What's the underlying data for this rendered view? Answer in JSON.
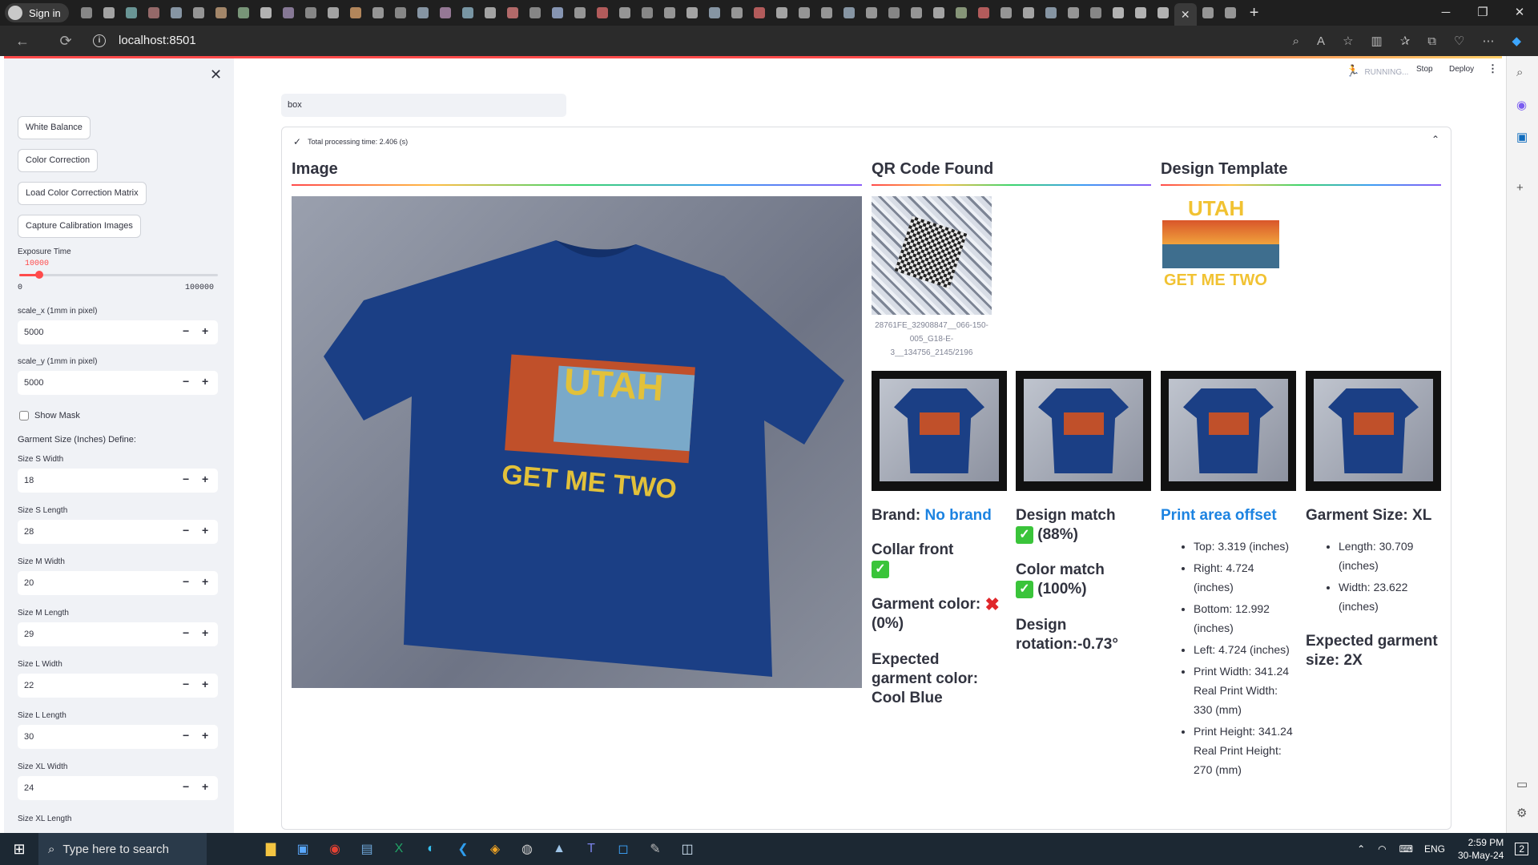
{
  "browser": {
    "signin": "Sign in",
    "url": "localhost:8501"
  },
  "streamlit": {
    "status": "RUNNING...",
    "stop": "Stop",
    "deploy": "Deploy",
    "box_value": "box",
    "processing": "Total processing time: 2.406 (s)"
  },
  "sidebar": {
    "buttons": [
      "White Balance",
      "Color Correction",
      "Load Color Correction Matrix",
      "Capture Calibration Images"
    ],
    "exposure": {
      "label": "Exposure Time",
      "value": "10000",
      "min": "0",
      "max": "100000",
      "fraction": 0.1
    },
    "scale_x": {
      "label": "scale_x (1mm in pixel)",
      "value": "5000"
    },
    "scale_y": {
      "label": "scale_y (1mm in pixel)",
      "value": "5000"
    },
    "show_mask": "Show Mask",
    "garment_define": "Garment Size (Inches) Define:",
    "sizes": [
      {
        "label": "Size S Width",
        "value": "18"
      },
      {
        "label": "Size S Length",
        "value": "28"
      },
      {
        "label": "Size M Width",
        "value": "20"
      },
      {
        "label": "Size M Length",
        "value": "29"
      },
      {
        "label": "Size L Width",
        "value": "22"
      },
      {
        "label": "Size L Length",
        "value": "30"
      },
      {
        "label": "Size XL Width",
        "value": "24"
      }
    ],
    "last_label": "Size XL Length"
  },
  "main": {
    "image_heading": "Image",
    "qr_heading": "QR Code Found",
    "template_heading": "Design Template",
    "qr_caption": "28761FE_32908847__066-150-005_G18-E-3__134756_2145/2196",
    "shirt_text_top": "UTAH",
    "shirt_text_bottom": "GET ME TWO",
    "brand_label": "Brand: ",
    "brand_value": "No brand",
    "collar": "Collar front",
    "garment_color": "Garment color:",
    "garment_color_pct": "(0%)",
    "expected_color": "Expected garment color: Cool Blue",
    "design_match": "Design match",
    "design_match_pct": "(88%)",
    "color_match": "Color match",
    "color_match_pct": "(100%)",
    "design_rotation": "Design rotation:-0.73°",
    "print_offset": "Print area offset",
    "offsets": [
      "Top: 3.319 (inches)",
      "Right: 4.724 (inches)",
      "Bottom: 12.992 (inches)",
      "Left: 4.724 (inches)",
      "Print Width: 341.24 Real Print Width: 330 (mm)",
      "Print Height: 341.24 Real Print Height: 270 (mm)"
    ],
    "garment_size": "Garment Size: XL",
    "size_items": [
      "Length: 30.709 (inches)",
      "Width: 23.622 (inches)"
    ],
    "expected_size": "Expected garment size: 2X"
  },
  "taskbar": {
    "search": "Type here to search",
    "lang": "ENG",
    "time": "2:59 PM",
    "date": "30-May-24",
    "notif": "2"
  }
}
